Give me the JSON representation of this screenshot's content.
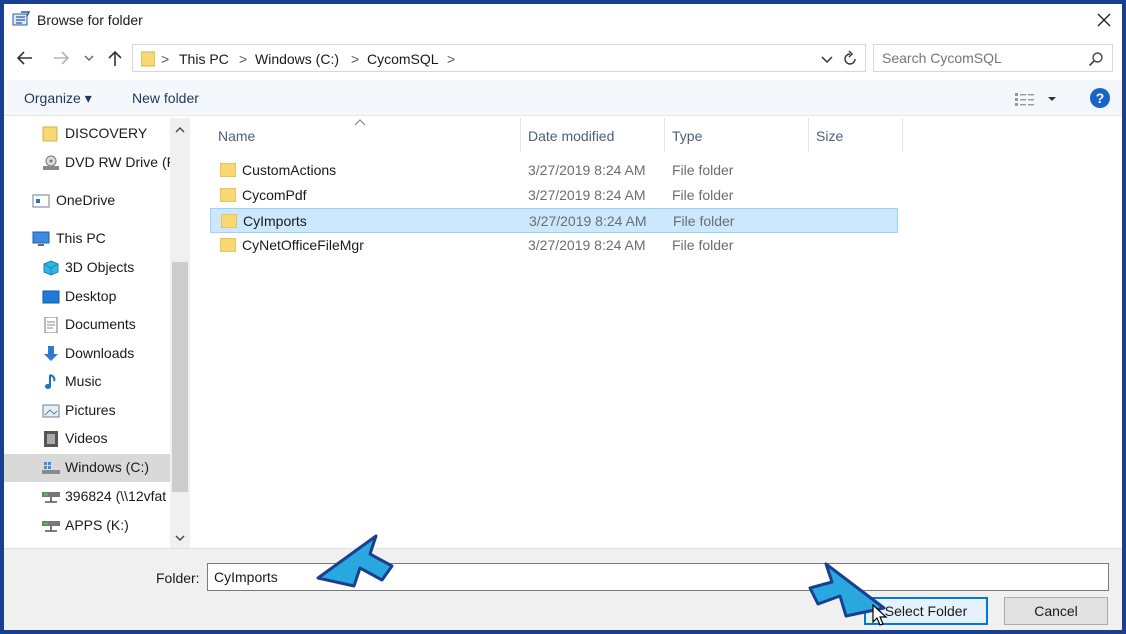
{
  "window": {
    "title": "Browse for folder",
    "close_glyph": "✕"
  },
  "nav": {
    "back_glyph": "←",
    "forward_glyph": "→",
    "recent_glyph": "⌄",
    "up_glyph": "↑"
  },
  "address": {
    "crumbs": [
      "This PC",
      "Windows (C:)",
      "CycomSQL"
    ],
    "separator": ">"
  },
  "search": {
    "placeholder": "Search CycomSQL"
  },
  "toolbar": {
    "organize_label": "Organize ▾",
    "new_folder_label": "New folder",
    "help_glyph": "?"
  },
  "navpane": {
    "items": [
      {
        "label": "DISCOVERY",
        "icon": "folder-icon"
      },
      {
        "label": "DVD RW Drive (F",
        "icon": "dvd-drive-icon"
      },
      {
        "label": "OneDrive",
        "icon": "onedrive-icon"
      },
      {
        "label": "This PC",
        "icon": "this-pc-icon"
      },
      {
        "label": "3D Objects",
        "icon": "3d-objects-icon"
      },
      {
        "label": "Desktop",
        "icon": "desktop-icon"
      },
      {
        "label": "Documents",
        "icon": "documents-icon"
      },
      {
        "label": "Downloads",
        "icon": "downloads-icon"
      },
      {
        "label": "Music",
        "icon": "music-icon"
      },
      {
        "label": "Pictures",
        "icon": "pictures-icon"
      },
      {
        "label": "Videos",
        "icon": "videos-icon"
      },
      {
        "label": "Windows (C:)",
        "icon": "windows-drive-icon",
        "selected": true
      },
      {
        "label": "396824 (\\\\12vfat",
        "icon": "network-drive-icon"
      },
      {
        "label": "APPS (K:)",
        "icon": "network-drive-icon"
      }
    ]
  },
  "files": {
    "columns": [
      "Name",
      "Date modified",
      "Type",
      "Size"
    ],
    "rows": [
      {
        "name": "CustomActions",
        "date": "3/27/2019 8:24 AM",
        "type": "File folder"
      },
      {
        "name": "CycomPdf",
        "date": "3/27/2019 8:24 AM",
        "type": "File folder"
      },
      {
        "name": "CyImports",
        "date": "3/27/2019 8:24 AM",
        "type": "File folder",
        "selected": true
      },
      {
        "name": "CyNetOfficeFileMgr",
        "date": "3/27/2019 8:24 AM",
        "type": "File folder"
      }
    ]
  },
  "footer": {
    "folder_label": "Folder:",
    "folder_value": "CyImports",
    "select_label": "Select Folder",
    "cancel_label": "Cancel"
  },
  "colors": {
    "frame_border": "#1b3f8f",
    "selection_fill": "#cce8ff",
    "callout_arrow": "#29a8e0",
    "callout_outline": "#1b3f8f"
  }
}
